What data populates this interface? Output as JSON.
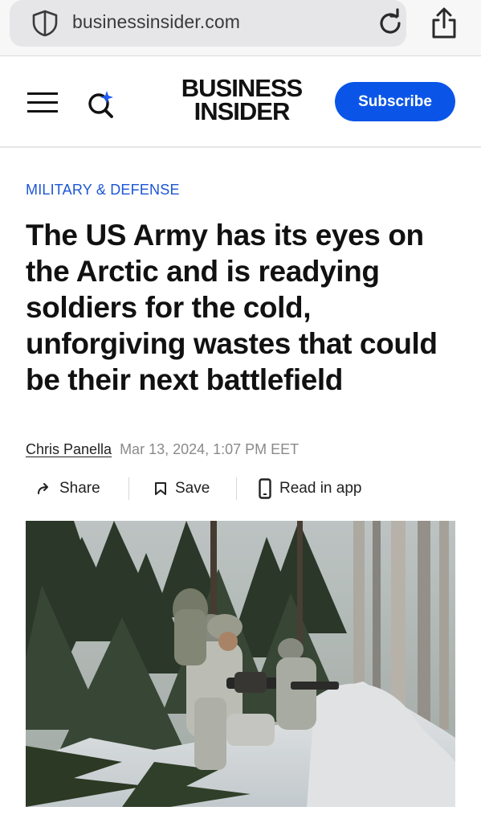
{
  "browser": {
    "url": "businessinsider.com",
    "icons": [
      "shield-icon",
      "reload-icon",
      "share-icon"
    ]
  },
  "header": {
    "logo_line1": "BUSINESS",
    "logo_line2": "INSIDER",
    "subscribe_label": "Subscribe",
    "icons": [
      "menu-icon",
      "search-ai-icon"
    ],
    "accent_color": "#0a55e8"
  },
  "article": {
    "category": "MILITARY & DEFENSE",
    "headline": "The US Army has its eyes on the Arctic and is readying soldiers for the cold, unforgiving wastes that could be their next battlefield",
    "author": "Chris Panella",
    "date": "Mar 13, 2024, 1:07 PM EET",
    "actions": {
      "share_label": "Share",
      "save_label": "Save",
      "app_label": "Read in app"
    },
    "category_color": "#1c56d6"
  }
}
